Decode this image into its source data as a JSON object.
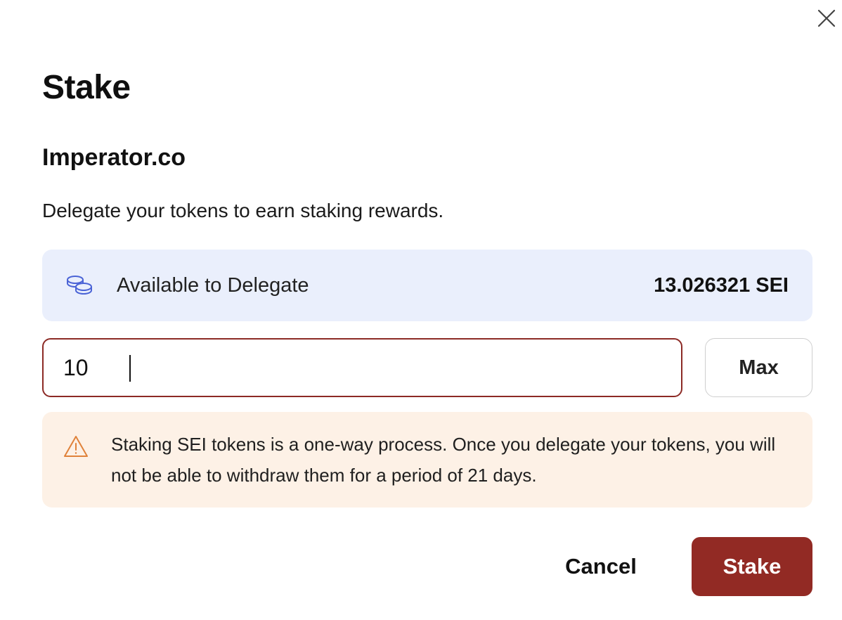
{
  "modal": {
    "title": "Stake",
    "validator_name": "Imperator.co",
    "description": "Delegate your tokens to earn staking rewards."
  },
  "available": {
    "label": "Available to Delegate",
    "value": "13.026321 SEI",
    "icon": "coins-icon"
  },
  "amount_input": {
    "value": "10"
  },
  "max_button": {
    "label": "Max"
  },
  "warning": {
    "icon": "warning-triangle-icon",
    "text": "Staking SEI tokens is a one-way process. Once you delegate your tokens, you will not be able to withdraw them for a period of 21 days."
  },
  "actions": {
    "cancel_label": "Cancel",
    "stake_label": "Stake"
  },
  "colors": {
    "primary": "#922a24",
    "input_border": "#8c2a25",
    "info_bg": "#eaeffc",
    "warning_bg": "#fdf1e6",
    "coin_icon": "#4a63d6",
    "warning_icon": "#e0823a"
  }
}
